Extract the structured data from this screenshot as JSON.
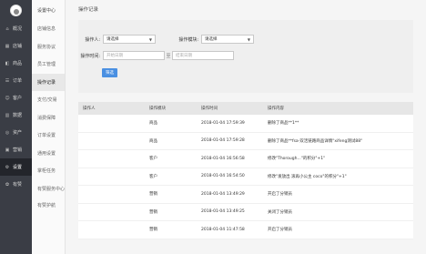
{
  "sidebar": {
    "items": [
      {
        "icon": "home-icon",
        "glyph": "⌂",
        "label": "概况"
      },
      {
        "icon": "store-icon",
        "glyph": "▦",
        "label": "店铺"
      },
      {
        "icon": "goods-icon",
        "glyph": "◧",
        "label": "商品"
      },
      {
        "icon": "order-icon",
        "glyph": "☰",
        "label": "订单"
      },
      {
        "icon": "customer-icon",
        "glyph": "☺",
        "label": "客户"
      },
      {
        "icon": "data-icon",
        "glyph": "▥",
        "label": "数据"
      },
      {
        "icon": "asset-icon",
        "glyph": "◎",
        "label": "资产"
      },
      {
        "icon": "marketing-icon",
        "glyph": "▣",
        "label": "营销"
      },
      {
        "icon": "settings-icon",
        "glyph": "⚙",
        "label": "设置"
      },
      {
        "icon": "favorite-icon",
        "glyph": "✿",
        "label": "有赞"
      }
    ],
    "active_index": 8
  },
  "subnav": {
    "title": "设置中心",
    "items": [
      "店铺信息",
      "服务协议",
      "员工管理",
      "操作记录",
      "支付/交易",
      "消费保障",
      "订单设置",
      "通用设置",
      "掌柜任务"
    ],
    "active_index": 3,
    "group_items": [
      "有赞服务中心",
      "有赞护航"
    ]
  },
  "header": {
    "title": "操作记录"
  },
  "filter": {
    "operator_label": "操作人:",
    "operator_value": "请选择",
    "module_label": "操作模块:",
    "module_value": "请选择",
    "time_label": "操作时间:",
    "start_placeholder": "开始日期",
    "end_placeholder": "结束日期",
    "range_sep": "至",
    "search_button": "筛选"
  },
  "table": {
    "headers": [
      "操作人",
      "操作模块",
      "操作时间",
      "操作内容"
    ],
    "rows": [
      {
        "operator": "",
        "module": "商品",
        "time": "2018-01-04 17:59:39",
        "content": "删除了商品**1**"
      },
      {
        "operator": "",
        "module": "商品",
        "time": "2018-01-04 17:59:28",
        "content": "删除了商品**fsa-双活链路商品详情\"xifeng测试88\""
      },
      {
        "operator": "",
        "module": "客户",
        "time": "2018-01-04 16:56:58",
        "content": "修改\"Thorough...\"的积分\"+1\""
      },
      {
        "operator": "",
        "module": "客户",
        "time": "2018-01-04 16:54:50",
        "content": "修改\"发放出 滚再小公主 coco\"的积分\"+1\""
      },
      {
        "operator": "",
        "module": "营销",
        "time": "2018-01-04 13:49:29",
        "content": "开启了分销员"
      },
      {
        "operator": "",
        "module": "营销",
        "time": "2018-01-04 13:49:25",
        "content": "关闭了分销员"
      },
      {
        "operator": "",
        "module": "营销",
        "time": "2018-01-04 11:47:58",
        "content": "开启了分销员"
      }
    ]
  }
}
